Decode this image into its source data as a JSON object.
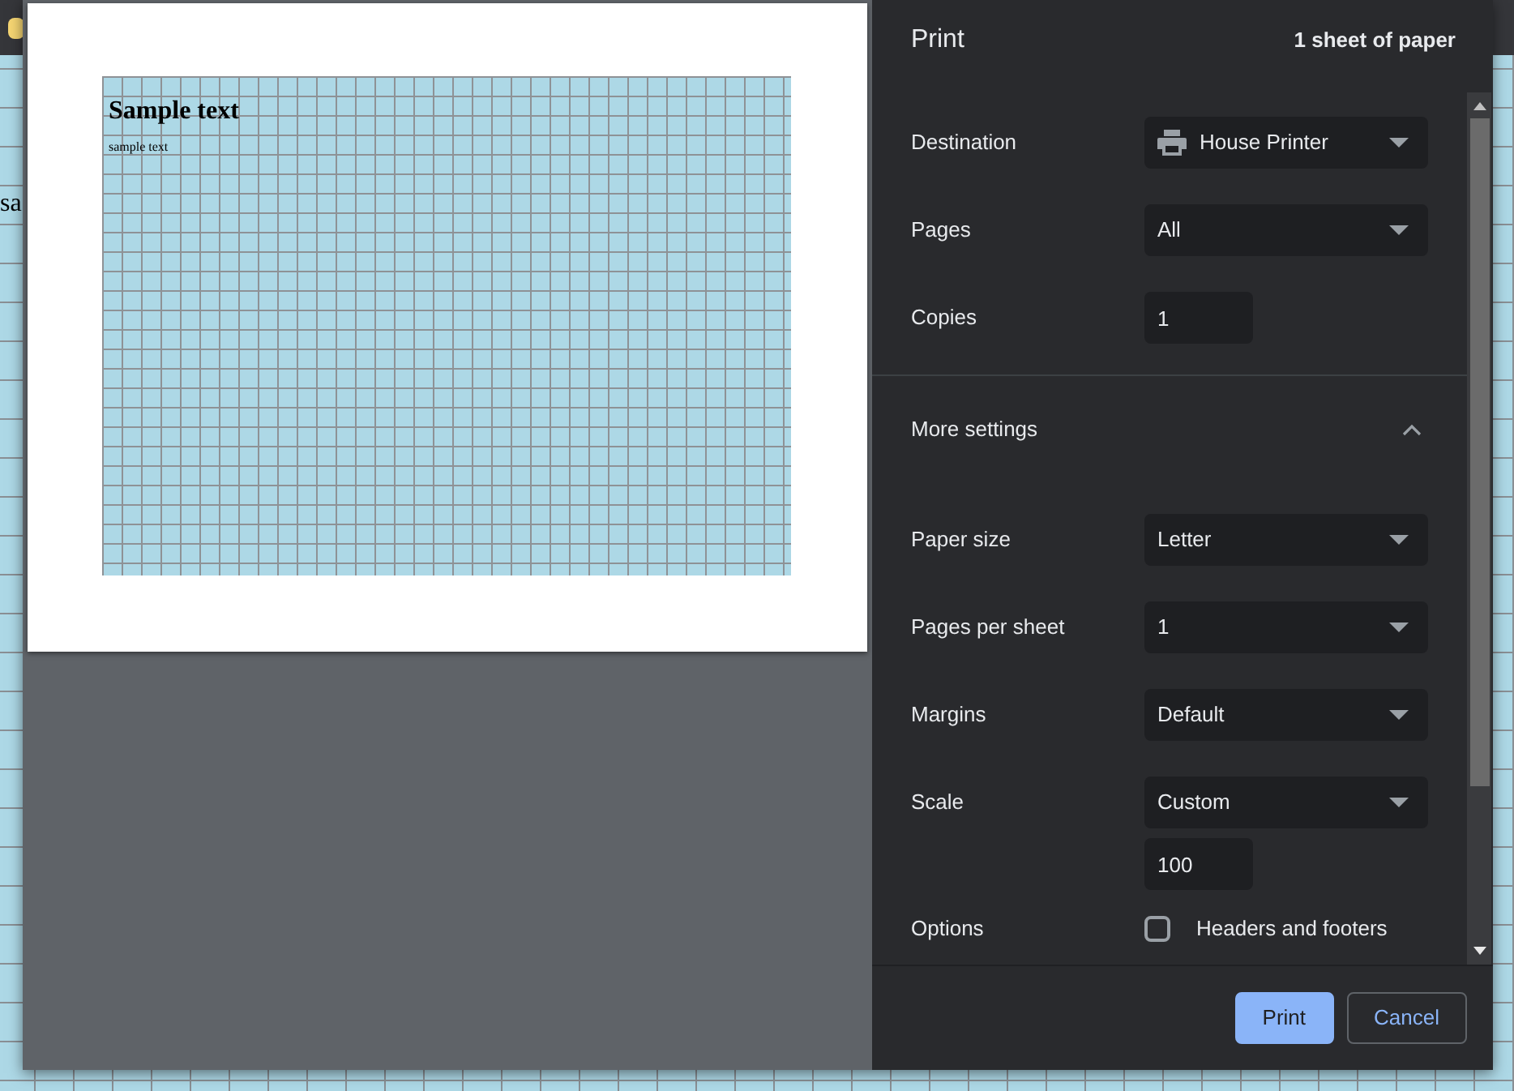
{
  "background_page": {
    "text": "sa"
  },
  "dialog": {
    "title": "Print",
    "sheet_count": "1 sheet of paper",
    "preview": {
      "heading": "Sample text",
      "text": "sample text"
    },
    "settings": [
      {
        "kind": "select",
        "label": "Destination",
        "value": "House Printer",
        "with_icon": true
      },
      {
        "kind": "select",
        "label": "Pages",
        "value": "All"
      },
      {
        "kind": "number",
        "label": "Copies",
        "value": "1"
      },
      {
        "kind": "section",
        "label": "More settings",
        "expanded": true
      },
      {
        "kind": "select",
        "label": "Paper size",
        "value": "Letter"
      },
      {
        "kind": "select",
        "label": "Pages per sheet",
        "value": "1"
      },
      {
        "kind": "select",
        "label": "Margins",
        "value": "Default"
      },
      {
        "kind": "select",
        "label": "Scale",
        "value": "Custom",
        "extra_value": "100"
      },
      {
        "kind": "checkbox",
        "label": "Options",
        "option": "Headers and footers",
        "checked": false
      }
    ],
    "buttons": [
      {
        "kind": "primary",
        "label": "Print"
      },
      {
        "kind": "secondary",
        "label": "Cancel"
      }
    ]
  }
}
